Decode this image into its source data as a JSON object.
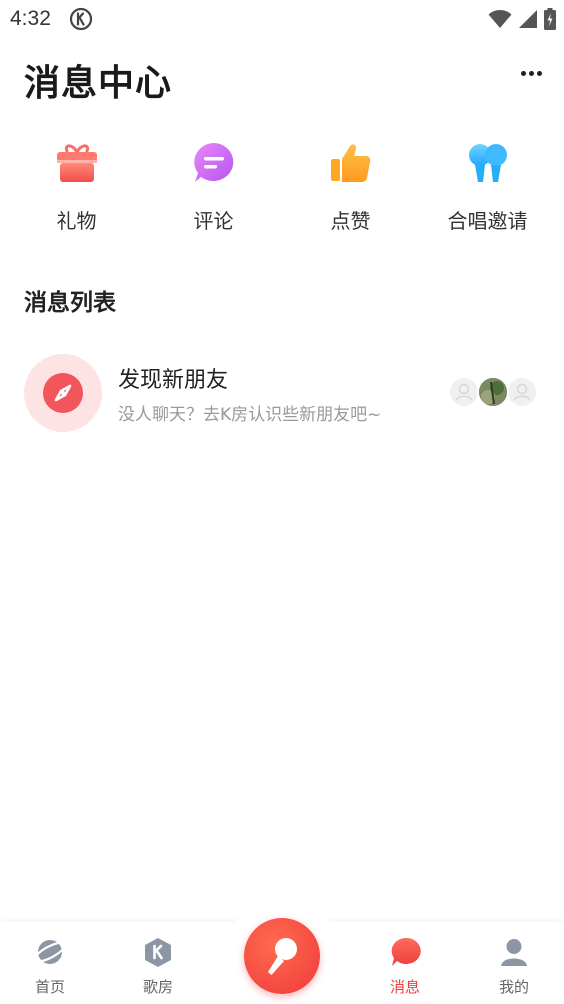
{
  "status_bar": {
    "time": "4:32"
  },
  "header": {
    "title": "消息中心"
  },
  "categories": [
    {
      "label": "礼物",
      "icon": "gift-icon"
    },
    {
      "label": "评论",
      "icon": "comment-icon"
    },
    {
      "label": "点赞",
      "icon": "thumbs-up-icon"
    },
    {
      "label": "合唱邀请",
      "icon": "duet-invite-icon"
    }
  ],
  "messages": {
    "section_title": "消息列表",
    "items": [
      {
        "title": "发现新朋友",
        "subtitle": "没人聊天？去K房认识些新朋友吧~",
        "icon": "compass-icon"
      }
    ]
  },
  "tab_bar": {
    "items": [
      {
        "label": "首页",
        "icon": "planet-icon",
        "active": false
      },
      {
        "label": "歌房",
        "icon": "k-room-icon",
        "active": false
      },
      {
        "label": "",
        "icon": "microphone-icon",
        "active": false
      },
      {
        "label": "消息",
        "icon": "chat-bubble-icon",
        "active": true
      },
      {
        "label": "我的",
        "icon": "profile-icon",
        "active": false
      }
    ]
  },
  "colors": {
    "accent": "#ee3d3d",
    "avatar_bg": "#fde3e3"
  }
}
